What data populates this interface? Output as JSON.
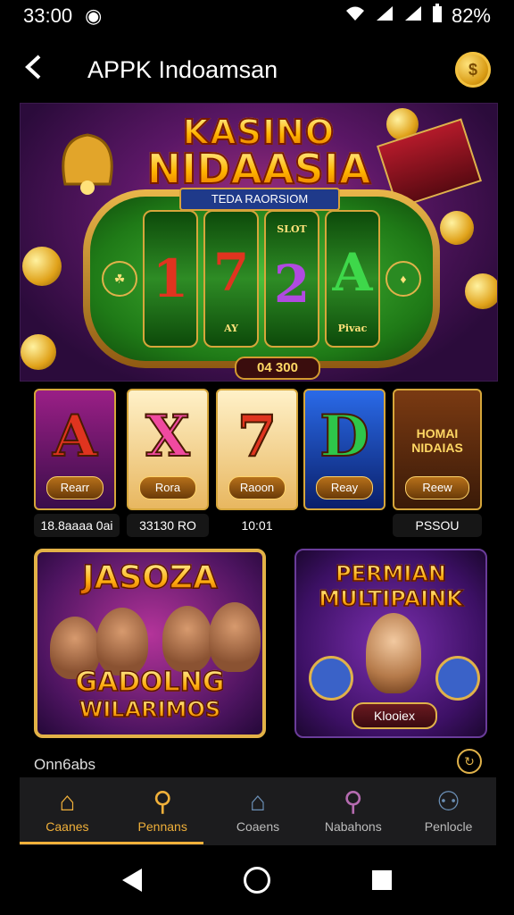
{
  "status": {
    "time": "33:00",
    "battery": "82%"
  },
  "appbar": {
    "title": "APPK Indoamsan",
    "back_icon": "arrow-left"
  },
  "hero": {
    "title_line1": "KASINO",
    "title_line2": "NIDAASIA",
    "subtitle": "TEDA RAORSIOM",
    "reels": [
      {
        "top": "",
        "main": "1",
        "bottom": ""
      },
      {
        "top": "",
        "main": "7",
        "bottom": "AY"
      },
      {
        "top": "SLOT",
        "main": "2",
        "bottom": ""
      },
      {
        "top": "",
        "main": "A",
        "bottom": "Pivac"
      }
    ],
    "amount": "04 300"
  },
  "tiles": [
    {
      "letter": "A",
      "button": "Rearr",
      "color": "#e0341f",
      "bg": "linear-gradient(#9a1f86,#3a0d4a)"
    },
    {
      "letter": "X",
      "button": "Rora",
      "color": "#f04aa0",
      "bg": "linear-gradient(#fff1c8,#e8b760)"
    },
    {
      "letter": "7",
      "button": "Raoon",
      "color": "#e0341f",
      "bg": "linear-gradient(#fff1c8,#e8b760)"
    },
    {
      "letter": "D",
      "button": "Reay",
      "color": "#2ec64a",
      "bg": "linear-gradient(#2a6ae8,#0a1f6a)"
    },
    {
      "letter": "",
      "button": "Reew",
      "color": "#ffd864",
      "bg": "linear-gradient(#7a3a12,#3a1a08)",
      "caption": "HOMAI NIDAIAS"
    }
  ],
  "tile_values": [
    "18.8aaaa 0ai",
    "33130 RO",
    "10:01",
    "PSSOU"
  ],
  "cards": {
    "card1": {
      "title": "JASOZA",
      "bottom1": "GADOLNG",
      "bottom2": "WILARIMOS"
    },
    "card2": {
      "title1": "PERMIAN",
      "title2": "MULTIPAINK",
      "button": "Klooiex"
    }
  },
  "footer": {
    "text": "Onn6abs"
  },
  "nav": [
    {
      "label": "Caanes",
      "icon": "home-icon",
      "glyph": "⌂"
    },
    {
      "label": "Pennans",
      "icon": "search-icon",
      "glyph": "⚲"
    },
    {
      "label": "Coaens",
      "icon": "house-icon",
      "glyph": "⌂"
    },
    {
      "label": "Nabahons",
      "icon": "search-icon",
      "glyph": "⚲"
    },
    {
      "label": "Penlocle",
      "icon": "profile-icon",
      "glyph": "⚇"
    }
  ]
}
